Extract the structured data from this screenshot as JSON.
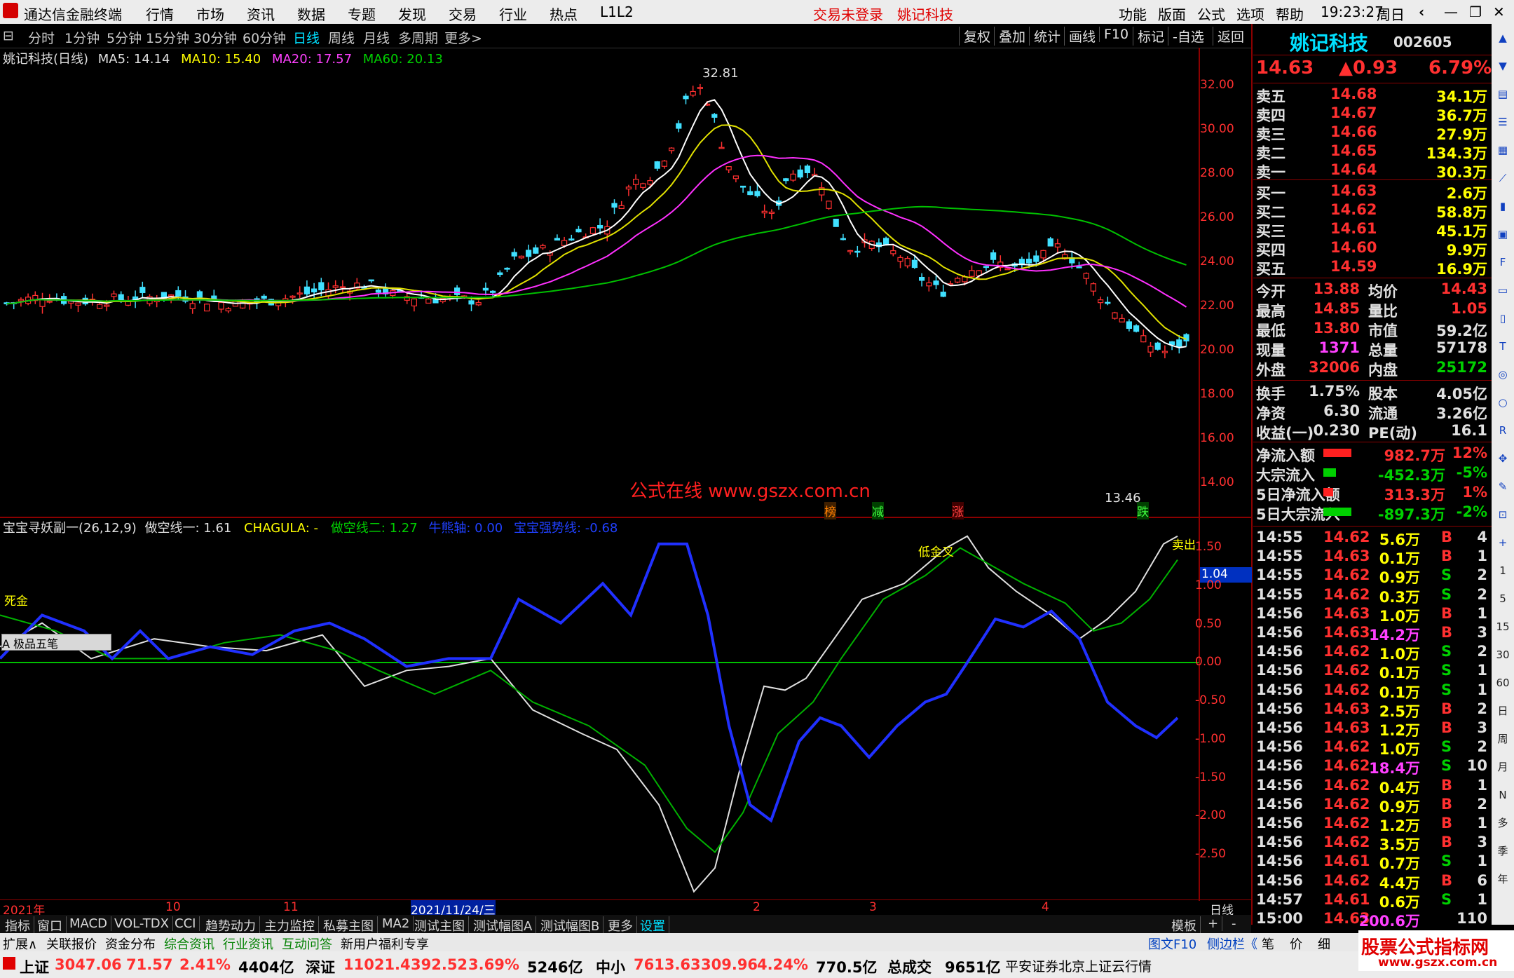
{
  "menubar": {
    "app_title": "通达信金融终端",
    "menus": [
      "行情",
      "市场",
      "资讯",
      "数据",
      "专题",
      "发现",
      "交易",
      "行业",
      "热点",
      "L1L2"
    ],
    "status_login": "交易未登录",
    "stock_name": "姚记科技",
    "right_menus": [
      "功能",
      "版面",
      "公式",
      "选项",
      "帮助"
    ],
    "time": "19:23:27",
    "weekday": "周日"
  },
  "periodbar": {
    "items": [
      "分时",
      "1分钟",
      "5分钟",
      "15分钟",
      "30分钟",
      "60分钟",
      "日线",
      "周线",
      "月线",
      "多周期",
      "更多>"
    ],
    "active": "日线",
    "right_buttons": [
      "复权",
      "叠加",
      "统计",
      "画线",
      "F10",
      "标记",
      "-自选",
      "返回"
    ]
  },
  "main_chart": {
    "legend_title": "姚记科技(日线)",
    "ma5": "MA5: 14.14",
    "ma10": "MA10: 15.40",
    "ma20": "MA20: 17.57",
    "ma60": "MA60: 20.13",
    "high_label": "32.81",
    "low_label": "13.46",
    "watermark": "公式在线  www.gszx.com.cn",
    "markers": [
      "榜",
      "减",
      "涨",
      "跌"
    ],
    "y_ticks": [
      "32.00",
      "30.00",
      "28.00",
      "26.00",
      "24.00",
      "22.00",
      "20.00",
      "18.00",
      "16.00",
      "14.00"
    ]
  },
  "sub_chart": {
    "legend": "宝宝寻妖副一(26,12,9)",
    "line1": "做空线一: 1.61",
    "line2": "CHAGULA: -",
    "line3": "做空线二: 1.27",
    "line4": "牛熊轴: 0.00",
    "line5": "宝宝强势线: -0.68",
    "current_value": "1.04",
    "signal1": "低金叉",
    "signal2": "死金",
    "signal3": "卖出",
    "toolbox": "A 极品五笔",
    "y_ticks": [
      "1.50",
      "1.00",
      "0.50",
      "0.00",
      "-0.50",
      "-1.00",
      "-1.50",
      "-2.00",
      "-2.50"
    ]
  },
  "time_axis": {
    "labels": [
      "2021年",
      "10",
      "11",
      "2021/11/24/三",
      "2",
      "3",
      "4"
    ],
    "right_label": "日线"
  },
  "tabbar1": {
    "items": [
      "指标",
      "窗口",
      "MACD",
      "VOL-TDX",
      "CCI",
      "趋势动力",
      "主力监控",
      "私募主图",
      "MA2",
      "测试主图",
      "测试幅图A",
      "测试幅图B",
      "更多",
      "设置"
    ],
    "right_items": [
      "模板",
      "+",
      "-"
    ]
  },
  "tabbar2": {
    "items": [
      "扩展∧",
      "关联报价",
      "资金分布",
      "综合资讯",
      "行业资讯",
      "互动问答",
      "新用户福利专享"
    ],
    "right_items": [
      "图文F10",
      "侧边栏《",
      "笔",
      "价",
      "细"
    ]
  },
  "quote_panel": {
    "name": "姚记科技",
    "code": "002605",
    "price": "14.63",
    "change": "▲0.93",
    "change_pct": "6.79%",
    "asks": [
      {
        "label": "卖五",
        "price": "14.68",
        "vol": "34.1万"
      },
      {
        "label": "卖四",
        "price": "14.67",
        "vol": "36.7万"
      },
      {
        "label": "卖三",
        "price": "14.66",
        "vol": "27.9万"
      },
      {
        "label": "卖二",
        "price": "14.65",
        "vol": "134.3万"
      },
      {
        "label": "卖一",
        "price": "14.64",
        "vol": "30.3万"
      }
    ],
    "bids": [
      {
        "label": "买一",
        "price": "14.63",
        "vol": "2.6万"
      },
      {
        "label": "买二",
        "price": "14.62",
        "vol": "58.8万"
      },
      {
        "label": "买三",
        "price": "14.61",
        "vol": "45.1万"
      },
      {
        "label": "买四",
        "price": "14.60",
        "vol": "9.9万"
      },
      {
        "label": "买五",
        "price": "14.59",
        "vol": "16.9万"
      }
    ],
    "stats": [
      {
        "l1": "今开",
        "v1": "13.88",
        "l2": "均价",
        "v2": "14.43",
        "c1": "red",
        "c2": "red"
      },
      {
        "l1": "最高",
        "v1": "14.85",
        "l2": "量比",
        "v2": "1.05",
        "c1": "red",
        "c2": "red"
      },
      {
        "l1": "最低",
        "v1": "13.80",
        "l2": "市值",
        "v2": "59.2亿",
        "c1": "red",
        "c2": "white"
      },
      {
        "l1": "现量",
        "v1": "1371",
        "l2": "总量",
        "v2": "57178",
        "c1": "mag",
        "c2": "white"
      },
      {
        "l1": "外盘",
        "v1": "32006",
        "l2": "内盘",
        "v2": "25172",
        "c1": "red",
        "c2": "green"
      }
    ],
    "stats2": [
      {
        "l1": "换手",
        "v1": "1.75%",
        "l2": "股本",
        "v2": "4.05亿"
      },
      {
        "l1": "净资",
        "v1": "6.30",
        "l2": "流通",
        "v2": "3.26亿"
      },
      {
        "l1": "收益(一)",
        "v1": "0.230",
        "l2": "PE(动)",
        "v2": "16.1"
      }
    ],
    "flows": [
      {
        "label": "净流入额",
        "value": "982.7万",
        "pct": "12%",
        "color": "red"
      },
      {
        "label": "大宗流入",
        "value": "-452.3万",
        "pct": "-5%",
        "color": "green"
      },
      {
        "label": "5日净流入额",
        "value": "313.3万",
        "pct": "1%",
        "color": "red"
      },
      {
        "label": "5日大宗流入",
        "value": "-897.3万",
        "pct": "-2%",
        "color": "green"
      }
    ],
    "ticks": [
      {
        "t": "14:55",
        "p": "14.62",
        "v": "5.6万",
        "s": "B",
        "n": "4"
      },
      {
        "t": "14:55",
        "p": "14.63",
        "v": "0.1万",
        "s": "B",
        "n": "1"
      },
      {
        "t": "14:55",
        "p": "14.62",
        "v": "0.9万",
        "s": "S",
        "n": "2"
      },
      {
        "t": "14:55",
        "p": "14.62",
        "v": "0.3万",
        "s": "S",
        "n": "2"
      },
      {
        "t": "14:56",
        "p": "14.63",
        "v": "1.0万",
        "s": "B",
        "n": "1"
      },
      {
        "t": "14:56",
        "p": "14.63",
        "v": "14.2万",
        "s": "B",
        "n": "3"
      },
      {
        "t": "14:56",
        "p": "14.62",
        "v": "1.0万",
        "s": "S",
        "n": "2"
      },
      {
        "t": "14:56",
        "p": "14.62",
        "v": "0.1万",
        "s": "S",
        "n": "1"
      },
      {
        "t": "14:56",
        "p": "14.62",
        "v": "0.1万",
        "s": "S",
        "n": "1"
      },
      {
        "t": "14:56",
        "p": "14.63",
        "v": "2.5万",
        "s": "B",
        "n": "2"
      },
      {
        "t": "14:56",
        "p": "14.63",
        "v": "1.2万",
        "s": "B",
        "n": "3"
      },
      {
        "t": "14:56",
        "p": "14.62",
        "v": "1.0万",
        "s": "S",
        "n": "2"
      },
      {
        "t": "14:56",
        "p": "14.62",
        "v": "18.4万",
        "s": "S",
        "n": "10"
      },
      {
        "t": "14:56",
        "p": "14.62",
        "v": "0.4万",
        "s": "B",
        "n": "1"
      },
      {
        "t": "14:56",
        "p": "14.62",
        "v": "0.9万",
        "s": "B",
        "n": "2"
      },
      {
        "t": "14:56",
        "p": "14.62",
        "v": "1.2万",
        "s": "B",
        "n": "1"
      },
      {
        "t": "14:56",
        "p": "14.62",
        "v": "3.5万",
        "s": "B",
        "n": "3"
      },
      {
        "t": "14:56",
        "p": "14.61",
        "v": "0.7万",
        "s": "S",
        "n": "1"
      },
      {
        "t": "14:56",
        "p": "14.62",
        "v": "4.4万",
        "s": "B",
        "n": "6"
      },
      {
        "t": "14:57",
        "p": "14.61",
        "v": "0.6万",
        "s": "S",
        "n": "1"
      },
      {
        "t": "15:00",
        "p": "14.63",
        "v": "200.6万",
        "s": "",
        "n": "110"
      }
    ]
  },
  "status_bar": {
    "items": [
      {
        "name": "上证",
        "value": "3047.06",
        "chg": "71.57",
        "pct": "2.41%",
        "amt": "4404亿"
      },
      {
        "name": "深证",
        "value": "11021.4",
        "chg": "392.52",
        "pct": "3.69%",
        "amt": "5246亿"
      },
      {
        "name": "中小",
        "value": "7613.63",
        "chg": "309.96",
        "pct": "4.24%",
        "amt": "770.5亿"
      }
    ],
    "total_label": "总成交",
    "total_value": "9651亿",
    "broker": "平安证券北京上证云行情",
    "site_logo": "股票公式指标网",
    "site_url": "www.gszx.com.cn"
  },
  "icon_strip": [
    "up-icon",
    "down-icon",
    "chart-icon",
    "list-icon",
    "grid-icon",
    "line-icon",
    "bar-icon",
    "news-icon",
    "f10-icon",
    "book-icon",
    "doc-icon",
    "tdx-icon",
    "ring-icon",
    "cir-icon",
    "rsi-icon",
    "move-icon",
    "pen-icon",
    "fs-icon",
    "plus-icon",
    "1",
    "5",
    "15",
    "30",
    "60",
    "日",
    "周",
    "月",
    "N",
    "多",
    "季",
    "年"
  ]
}
